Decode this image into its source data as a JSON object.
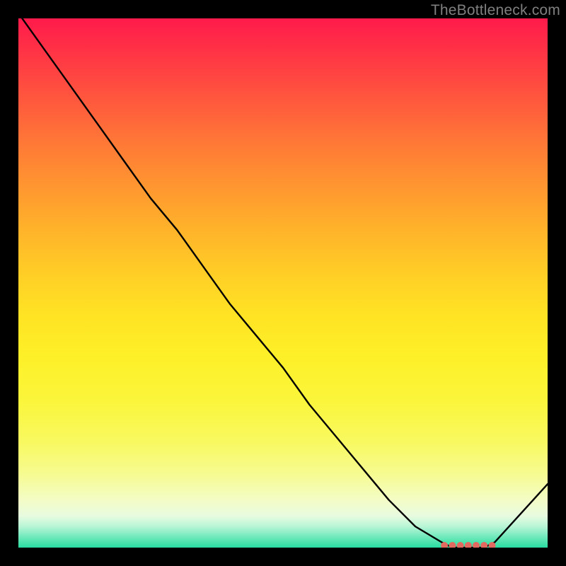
{
  "watermark": "TheBottleneck.com",
  "chart_data": {
    "type": "line",
    "title": "",
    "xlabel": "",
    "ylabel": "",
    "xlim": [
      0,
      100
    ],
    "ylim": [
      0,
      100
    ],
    "series": [
      {
        "name": "curve",
        "x": [
          0,
          5,
          10,
          15,
          20,
          25,
          30,
          35,
          40,
          45,
          50,
          55,
          60,
          65,
          70,
          75,
          80,
          82,
          85,
          88,
          90,
          100
        ],
        "values": [
          101,
          94,
          87,
          80,
          73,
          66,
          60,
          53,
          46,
          40,
          34,
          27,
          21,
          15,
          9,
          4,
          1,
          0,
          0,
          0,
          1,
          12
        ]
      }
    ],
    "flat_markers_x": [
      80.5,
      82,
      83.5,
      85,
      86.5,
      88,
      89.5
    ]
  },
  "colors": {
    "curve": "#000000",
    "markers": "#e2695f"
  }
}
